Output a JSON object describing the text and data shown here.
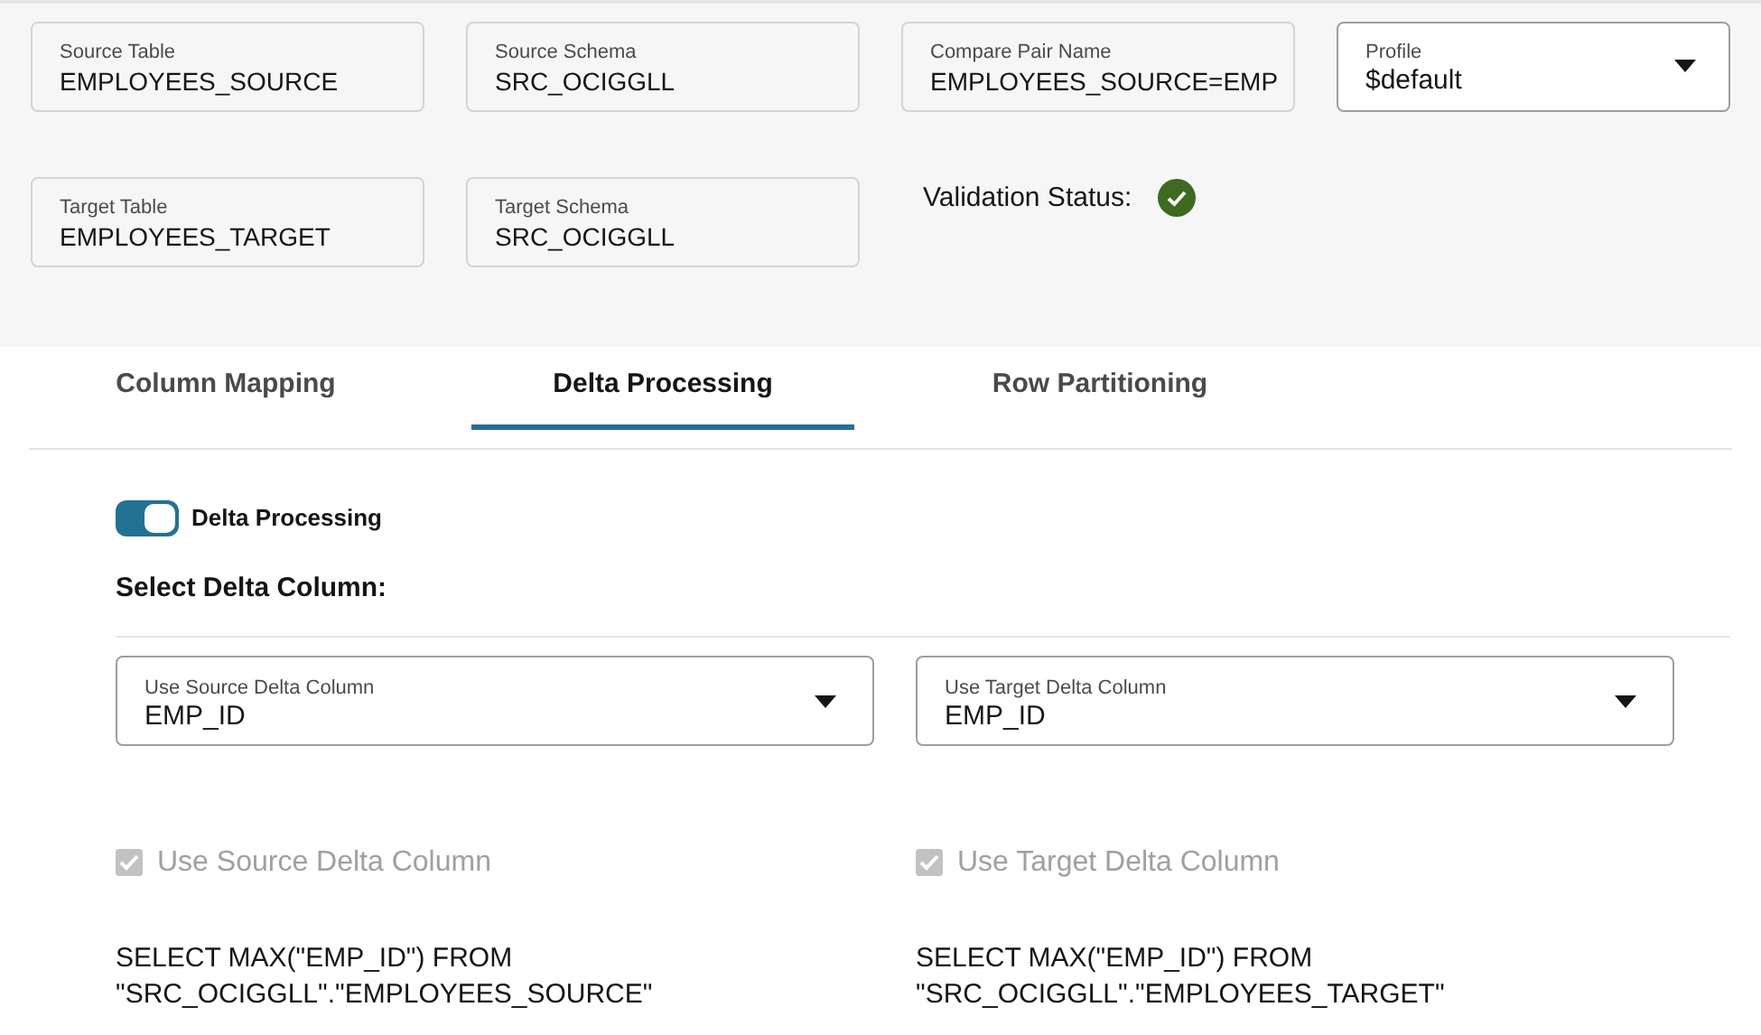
{
  "form_rows": [
    [
      {
        "kind": "text",
        "label": "Source Table",
        "value": "EMPLOYEES_SOURCE"
      },
      {
        "kind": "text",
        "label": "Source Schema",
        "value": "SRC_OCIGGLL"
      },
      {
        "kind": "text",
        "label": "Compare Pair Name",
        "value": "EMPLOYEES_SOURCE=EMP"
      },
      {
        "kind": "select",
        "label": "Profile",
        "value": "$default"
      }
    ],
    [
      {
        "kind": "text",
        "label": "Target Table",
        "value": "EMPLOYEES_TARGET"
      },
      {
        "kind": "text",
        "label": "Target Schema",
        "value": "SRC_OCIGGLL"
      },
      {
        "kind": "status",
        "label": "Validation Status:",
        "valid": true
      }
    ]
  ],
  "tabs": [
    {
      "label": "Column Mapping",
      "selected": false
    },
    {
      "label": "Delta Processing",
      "selected": true
    },
    {
      "label": "Row Partitioning",
      "selected": false
    }
  ],
  "delta_toggle": {
    "label": "Delta Processing",
    "on": true
  },
  "section_title": "Select Delta Column:",
  "delta_columns": [
    {
      "label": "Use Source Delta Column",
      "value": "EMP_ID",
      "checkbox": {
        "label": "Use Source Delta Column",
        "checked": true,
        "disabled": true
      },
      "query": "SELECT MAX(\"EMP_ID\") FROM \"SRC_OCIGGLL\".\"EMPLOYEES_SOURCE\""
    },
    {
      "label": "Use Target Delta Column",
      "value": "EMP_ID",
      "checkbox": {
        "label": "Use Target Delta Column",
        "checked": true,
        "disabled": true
      },
      "query": "SELECT MAX(\"EMP_ID\") FROM \"SRC_OCIGGLL\".\"EMPLOYEES_TARGET\""
    }
  ]
}
